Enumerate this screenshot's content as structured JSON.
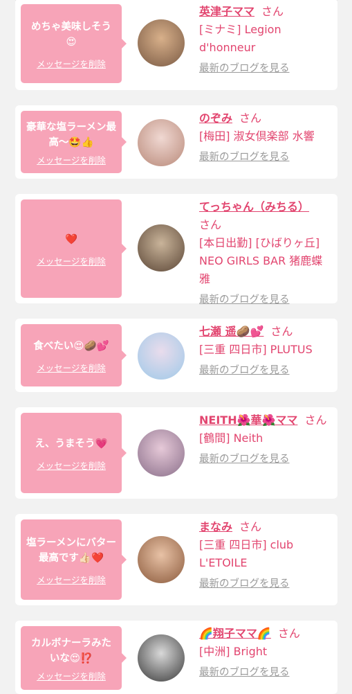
{
  "cards": [
    {
      "message": "めちゃ美味しそう😍",
      "delete_label": "メッセージを削除",
      "name": "英津子ママ",
      "honorific": "さん",
      "shop": "[ミナミ] Legion d'honneur",
      "blog_label": "最新のブログを見る",
      "avatar_colors": [
        "#d8b08a",
        "#7a5a44"
      ]
    },
    {
      "message": "豪華な塩ラーメン最高〜🤩👍",
      "delete_label": "メッセージを削除",
      "name": "のぞみ",
      "honorific": "さん",
      "shop": "[梅田] 淑女倶楽部 水響",
      "blog_label": "最新のブログを見る",
      "avatar_colors": [
        "#f0d8d2",
        "#b98a7a"
      ]
    },
    {
      "message": "❤️",
      "delete_label": "メッセージを削除",
      "name": "てっちゃん（みちる）",
      "honorific": "さん",
      "shop": "[本日出勤] [ひばりヶ丘] NEO GIRLS BAR 猪鹿蝶 雅",
      "blog_label": "最新のブログを見る",
      "avatar_colors": [
        "#c9b49a",
        "#5b4636"
      ]
    },
    {
      "message": "食べたい😍🥔💕",
      "delete_label": "メッセージを削除",
      "name": "七瀬 遥🥔💕",
      "honorific": "さん",
      "shop": "[三重 四日市] PLUTUS",
      "blog_label": "最新のブログを見る",
      "avatar_colors": [
        "#e9dcec",
        "#9fc9e8"
      ]
    },
    {
      "message": "え、うまそう💗",
      "delete_label": "メッセージを削除",
      "name": "NEITH🌺華🌺ママ",
      "honorific": "さん",
      "shop": "[鶴間] Neith",
      "blog_label": "最新のブログを見る",
      "avatar_colors": [
        "#e6c9d8",
        "#8a6f8a"
      ]
    },
    {
      "message": "塩ラーメンにバター最高です👍🏻❤️",
      "delete_label": "メッセージを削除",
      "name": "まなみ",
      "honorific": "さん",
      "shop": "[三重 四日市] club L'ETOILE",
      "blog_label": "最新のブログを見る",
      "avatar_colors": [
        "#e8c2a6",
        "#8b5a3c"
      ]
    },
    {
      "message": "カルボナーラみたいな😍⁉️",
      "delete_label": "メッセージを削除",
      "name": "🌈翔子ママ🌈",
      "honorific": "さん",
      "shop": "[中洲] Bright",
      "blog_label": "最新のブログを見る",
      "avatar_colors": [
        "#d9d9d9",
        "#3a3a3a"
      ]
    }
  ]
}
